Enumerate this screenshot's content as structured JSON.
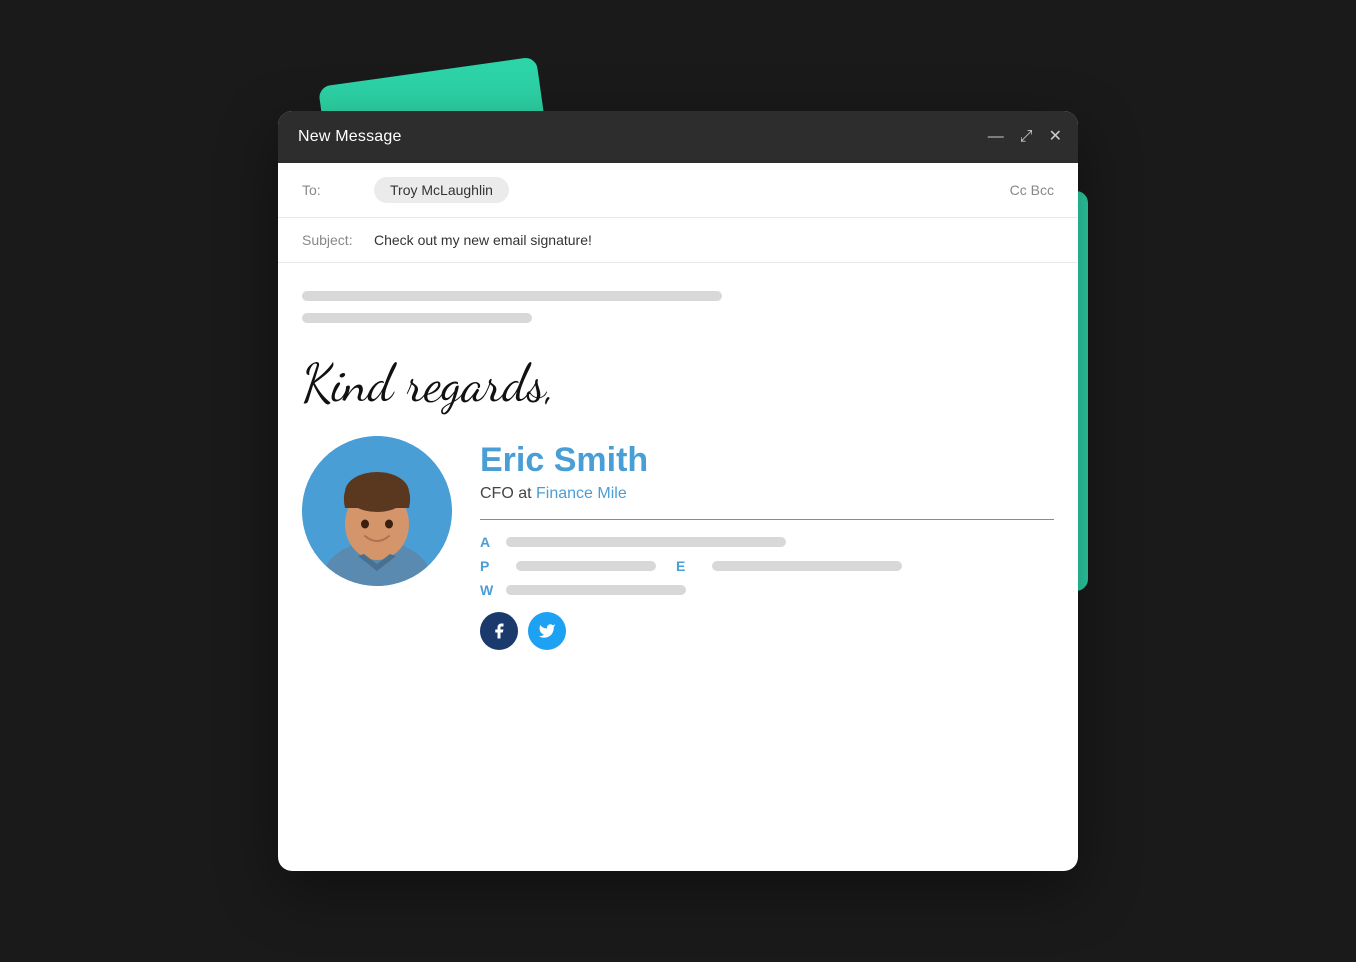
{
  "window": {
    "title": "New Message",
    "controls": {
      "minimize": "—",
      "maximize": "⤢",
      "close": "✕"
    }
  },
  "email": {
    "to_label": "To:",
    "recipient": "Troy McLaughlin",
    "cc_bcc": "Cc  Bcc",
    "subject_label": "Subject:",
    "subject": "Check out my new email signature!"
  },
  "signature": {
    "greeting": "Kind regards,",
    "name": "Eric Smith",
    "title_prefix": "CFO at ",
    "company": "Finance Mile",
    "divider_color": "#4a9ed6",
    "detail_keys": {
      "address": "A",
      "phone": "P",
      "email": "E",
      "website": "W"
    },
    "social": {
      "facebook_label": "Facebook",
      "twitter_label": "Twitter"
    }
  },
  "colors": {
    "teal": "#2dd4a7",
    "blue": "#4a9ed6",
    "titlebar": "#2d2d2d",
    "facebook": "#1a3a6e",
    "twitter": "#1da1f2"
  }
}
